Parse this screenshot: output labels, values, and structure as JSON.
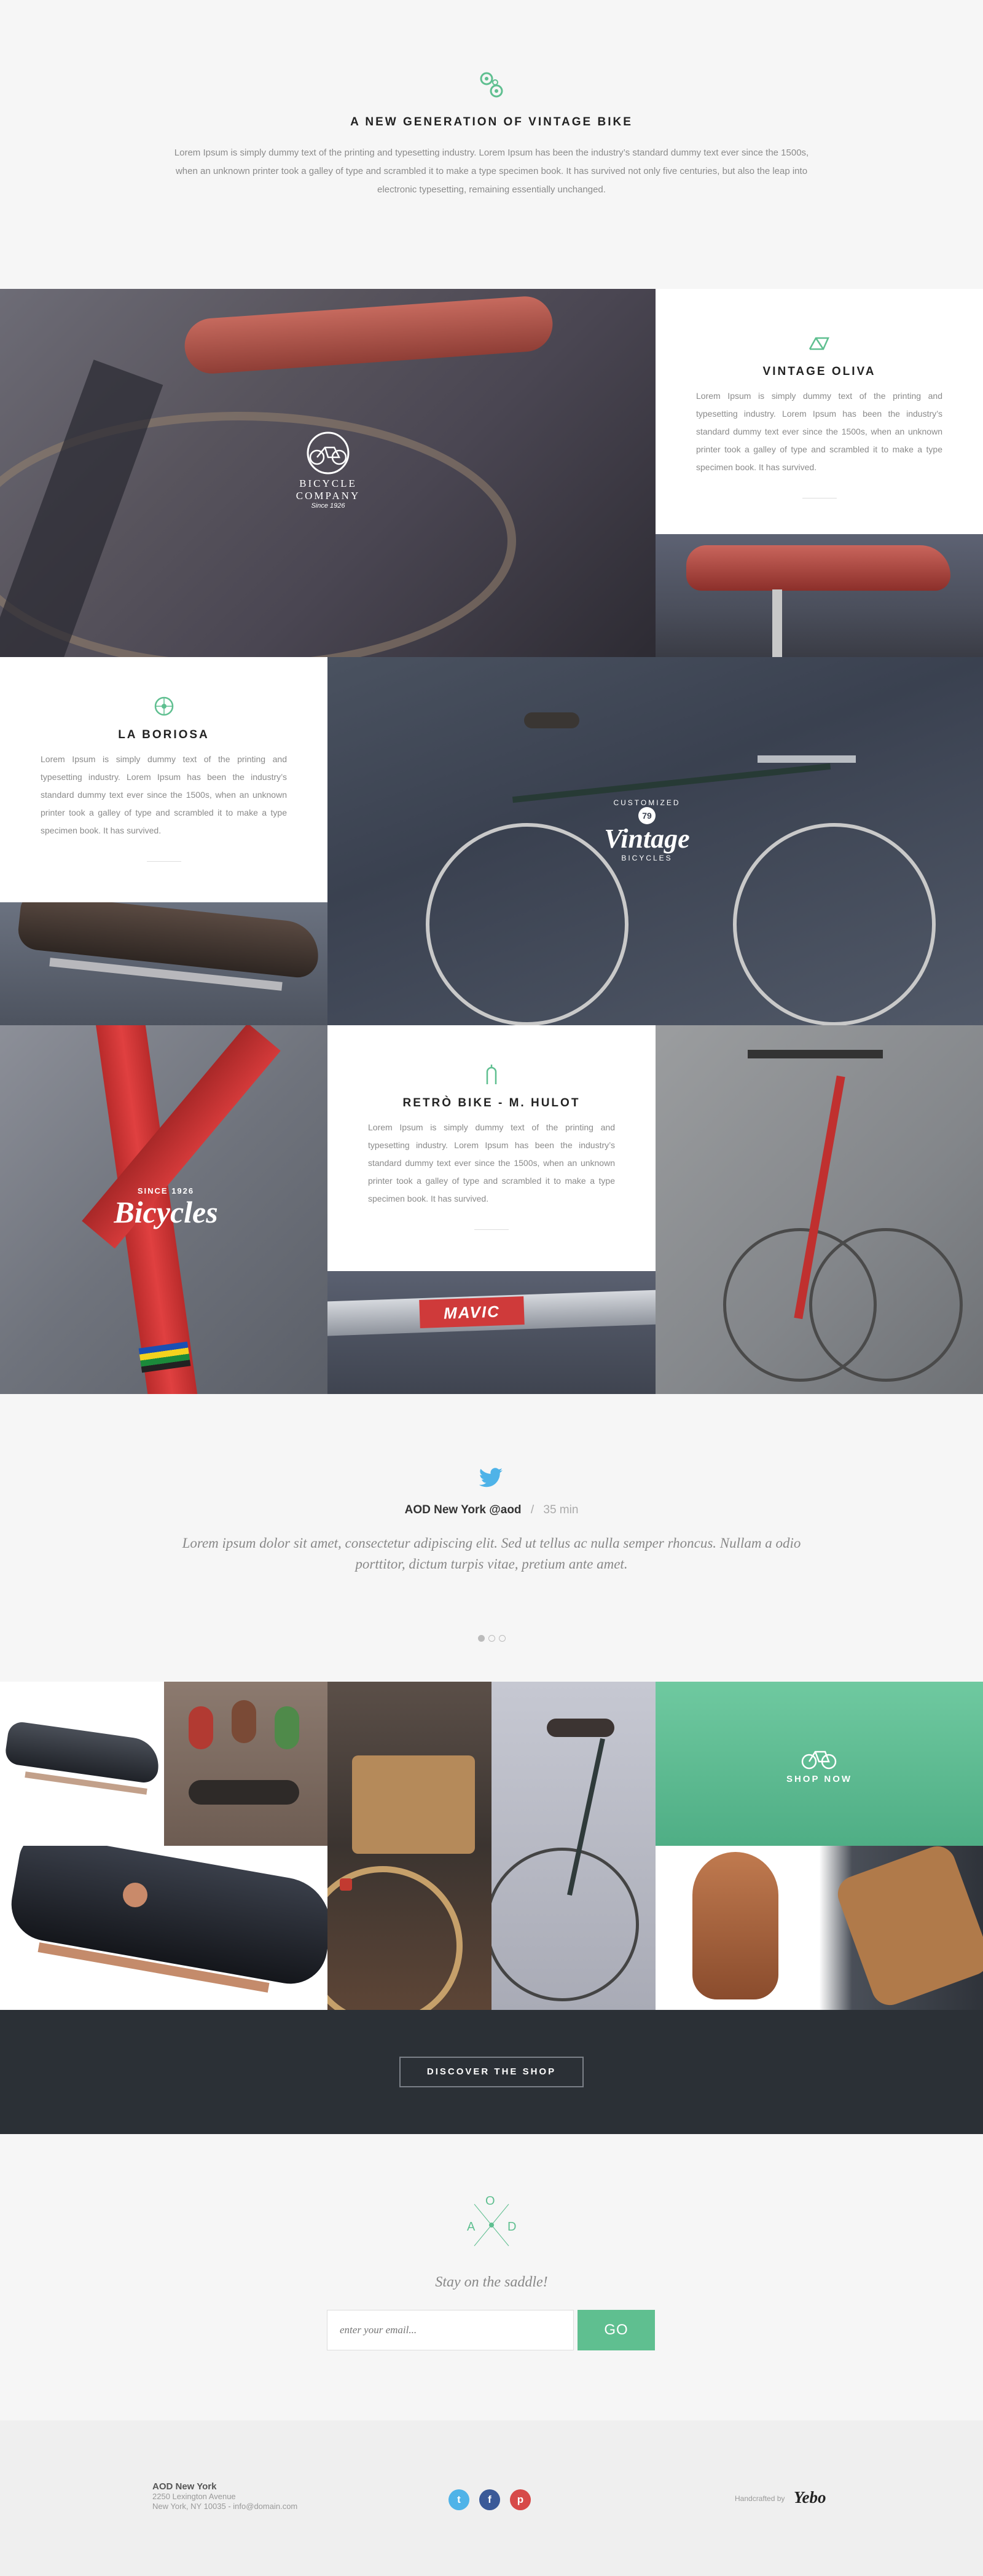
{
  "intro": {
    "title": "A NEW GENERATION OF VINTAGE BIKE",
    "text": "Lorem Ipsum is simply dummy text of the printing and typesetting industry. Lorem Ipsum has been the industry’s standard dummy text ever since the 1500s, when an unknown printer took a galley of type and scrambled it to make a type specimen book. It has survived not only five centuries, but also the leap into electronic typesetting, remaining essentially unchanged."
  },
  "logos": {
    "bicycle_company": {
      "line1": "BICYCLE",
      "line2": "COMPANY",
      "line3": "Since 1926"
    },
    "vintage": {
      "top": "CUSTOMIZED",
      "number": "79",
      "word": "Vintage",
      "bottom": "BICYCLES"
    },
    "bicycles": {
      "since": "SINCE 1926",
      "word": "Bicycles"
    }
  },
  "cards": [
    {
      "title": "VINTAGE OLIVA",
      "icon": "bike-frame-icon",
      "text": "Lorem Ipsum is simply dummy text of the printing and typesetting industry. Lorem Ipsum has been the industry’s standard dummy text ever since the 1500s, when an unknown printer took a galley of type and scrambled it to make a type specimen book. It has survived."
    },
    {
      "title": "LA BORIOSA",
      "icon": "wheel-icon",
      "text": "Lorem Ipsum is simply dummy text of the printing and typesetting industry. Lorem Ipsum has been the industry’s standard dummy text ever since the 1500s, when an unknown printer took a galley of type and scrambled it to make a type specimen book. It has survived."
    },
    {
      "title": "RETRÒ BIKE - M. HULOT",
      "icon": "fork-icon",
      "text": "Lorem Ipsum is simply dummy text of the printing and typesetting industry. Lorem Ipsum has been the industry’s standard dummy text ever since the 1500s, when an unknown printer took a galley of type and scrambled it to make a type specimen book. It has survived."
    }
  ],
  "rim_label": "MAVIC",
  "tweet": {
    "author": "AOD New York",
    "handle": "@aod",
    "separator": "/",
    "time": "35 min",
    "text": "Lorem ipsum dolor sit amet, consectetur adipiscing elit. Sed ut tellus ac nulla semper rhoncus. Nullam a odio porttitor, dictum turpis vitae, pretium ante amet."
  },
  "shop": {
    "shop_now": "SHOP NOW",
    "discover": "DISCOVER THE SHOP"
  },
  "newsletter": {
    "mark_letters": [
      "A",
      "O",
      "D"
    ],
    "stay": "Stay on the saddle!",
    "placeholder": "enter your email...",
    "go": "GO"
  },
  "footer": {
    "name": "AOD New York",
    "address1": "2250 Lexington Avenue",
    "address2": "New York, NY 10035  -  info@domain.com",
    "social": [
      {
        "icon": "twitter-icon",
        "glyph": "t",
        "color": "#4fb3e8"
      },
      {
        "icon": "facebook-icon",
        "glyph": "f",
        "color": "#3b5a98"
      },
      {
        "icon": "pinterest-icon",
        "glyph": "p",
        "color": "#d74a49"
      }
    ],
    "handcrafted": "Handcrafted by",
    "maker": "Yebo"
  },
  "colors": {
    "accent": "#5fbf90",
    "dark": "#2b3036",
    "twitter": "#4fb3e8"
  }
}
